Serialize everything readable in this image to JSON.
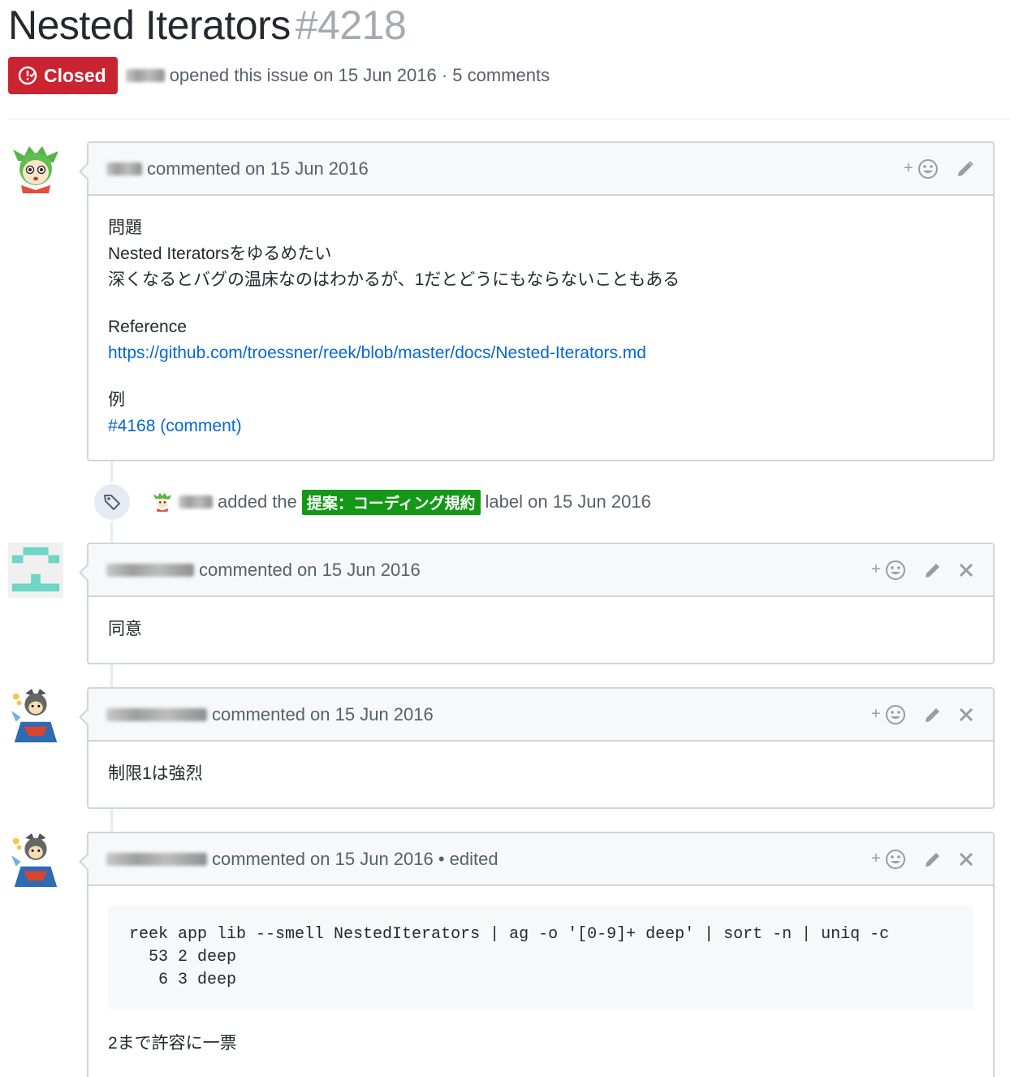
{
  "issue": {
    "title": "Nested Iterators",
    "number": "#4218",
    "state": "Closed",
    "meta": "opened this issue on 15 Jun 2016 · 5 comments"
  },
  "comments": [
    {
      "header": "commented on 15 Jun 2016",
      "body": {
        "heading": "問題",
        "line1": "Nested Iteratorsをゆるめたい",
        "line2": "深くなるとバグの温床なのはわかるが、1だとどうにもならないこともある",
        "ref_label": "Reference",
        "ref_link": "https://github.com/troessner/reek/blob/master/docs/Nested-Iterators.md",
        "example_label": "例",
        "example_link": "#4168 (comment)"
      }
    },
    {
      "header": "commented on 15 Jun 2016",
      "body": {
        "text": "同意"
      }
    },
    {
      "header": "commented on 15 Jun 2016",
      "body": {
        "text": "制限1は強烈"
      }
    },
    {
      "header": "commented on 15 Jun 2016 • edited",
      "body": {
        "code": "reek app lib --smell NestedIterators | ag -o '[0-9]+ deep' | sort -n | uniq -c\n  53 2 deep\n   6 3 deep",
        "text": "2まで許容に一票"
      }
    }
  ],
  "event": {
    "prefix": "added the",
    "label": "提案：コーディング規約",
    "label_color": "#159818",
    "suffix": "label on 15 Jun 2016"
  },
  "icons": {
    "add_reaction": "+☺",
    "edit": "pencil-icon",
    "delete": "close-icon",
    "tag": "tag-icon",
    "closed": "issue-closed-icon"
  }
}
